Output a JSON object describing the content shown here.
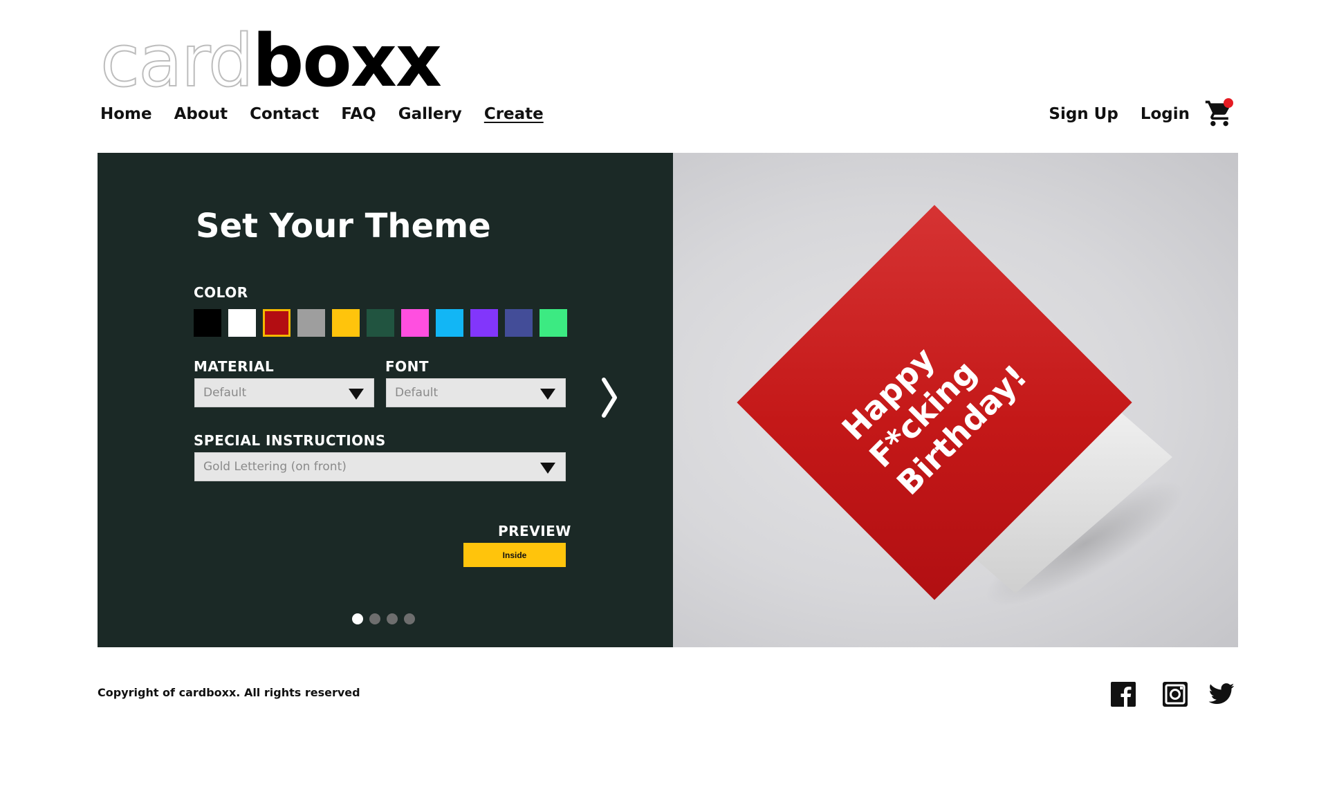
{
  "logo": {
    "light": "card",
    "bold": "boxx"
  },
  "nav": {
    "items": [
      {
        "label": "Home"
      },
      {
        "label": "About"
      },
      {
        "label": "Contact"
      },
      {
        "label": "FAQ"
      },
      {
        "label": "Gallery"
      },
      {
        "label": "Create"
      }
    ],
    "active": "Create",
    "signup": "Sign Up",
    "login": "Login",
    "cart_icon": "shopping-cart-icon",
    "cart_badge_color": "#e51c23"
  },
  "theme": {
    "title": "Set Your Theme",
    "color_label": "COLOR",
    "colors": [
      "#000000",
      "#ffffff",
      "#b30d12",
      "#9e9e9e",
      "#ffc40c",
      "#215440",
      "#ff4fe0",
      "#12b6f5",
      "#8236fb",
      "#434d98",
      "#3cea82"
    ],
    "selected_color": "#b30d12",
    "material_label": "MATERIAL",
    "material_value": "Default",
    "font_label": "FONT",
    "font_value": "Default",
    "instructions_label": "SPECIAL INSTRUCTIONS",
    "instructions_value": "Gold Lettering (on front)",
    "preview_label": "PREVIEW",
    "preview_button": "Inside",
    "steps_total": 4,
    "step_current": 1
  },
  "card": {
    "line1": "Happy",
    "line2": "F*cking",
    "line3": "Birthday!",
    "color": "#c41818"
  },
  "footer": {
    "copyright": "Copyright of cardboxx. All rights reserved",
    "social": [
      "facebook-icon",
      "instagram-icon",
      "twitter-icon"
    ]
  },
  "colors": {
    "panel_bg": "#1b2926",
    "accent": "#ffc40c"
  }
}
